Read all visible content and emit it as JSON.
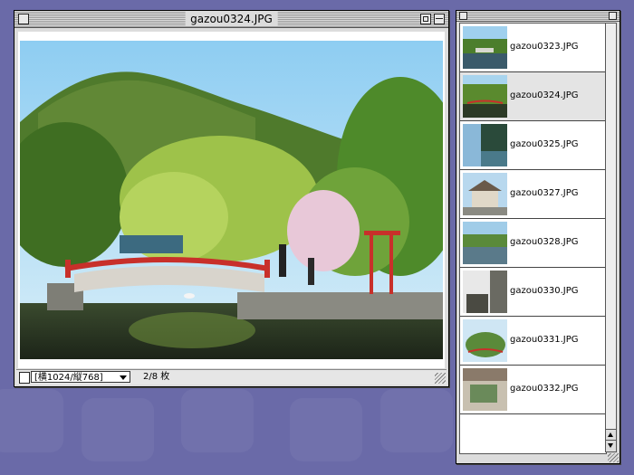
{
  "main_window": {
    "title": "gazou0324.JPG",
    "resolution_select": "[横1024/縦768]",
    "image_count": "2/8 枚"
  },
  "thumbnail_window": {
    "items": [
      {
        "label": "gazou0323.JPG",
        "selected": false
      },
      {
        "label": "gazou0324.JPG",
        "selected": true
      },
      {
        "label": "gazou0325.JPG",
        "selected": false
      },
      {
        "label": "gazou0327.JPG",
        "selected": false
      },
      {
        "label": "gazou0328.JPG",
        "selected": false
      },
      {
        "label": "gazou0330.JPG",
        "selected": false
      },
      {
        "label": "gazou0331.JPG",
        "selected": false
      },
      {
        "label": "gazou0332.JPG",
        "selected": false
      }
    ]
  },
  "colors": {
    "desktop": "#6a6aa8",
    "bridge": "#c8302a"
  }
}
